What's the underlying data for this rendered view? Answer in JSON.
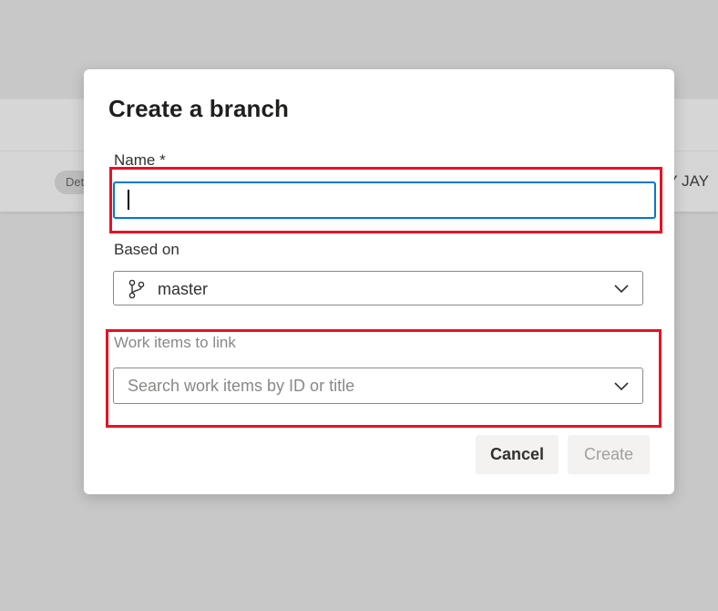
{
  "background": {
    "pill_text": "Det",
    "user_text": "Y JAY"
  },
  "dialog": {
    "title": "Create a branch",
    "name_label": "Name *",
    "name_value": "",
    "based_on_label": "Based on",
    "based_on_value": "master",
    "work_items_label": "Work items to link",
    "work_items_placeholder": "Search work items by ID or title",
    "cancel_label": "Cancel",
    "create_label": "Create"
  },
  "icons": {
    "branch": "git-branch-icon",
    "dropdown": "chevron-down-icon"
  },
  "colors": {
    "focus_border": "#0078d4",
    "highlight": "#e81123",
    "overlay": "#c8c8c8"
  }
}
